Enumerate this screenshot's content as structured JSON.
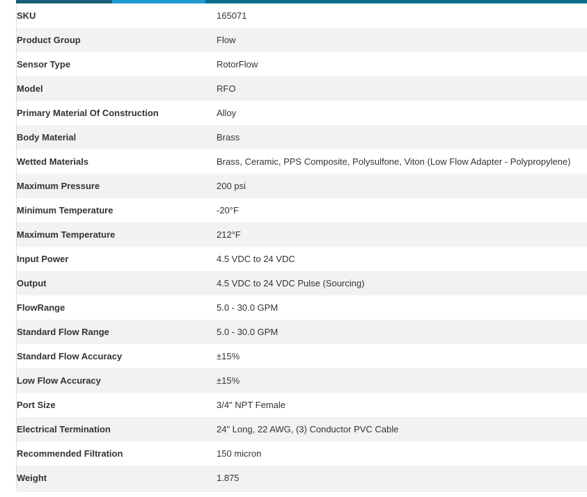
{
  "specifications": {
    "rows": [
      {
        "label": "SKU",
        "value": "165071"
      },
      {
        "label": "Product Group",
        "value": "Flow"
      },
      {
        "label": "Sensor Type",
        "value": "RotorFlow"
      },
      {
        "label": "Model",
        "value": "RFO"
      },
      {
        "label": "Primary Material Of Construction",
        "value": "Alloy"
      },
      {
        "label": "Body Material",
        "value": "Brass"
      },
      {
        "label": "Wetted Materials",
        "value": "Brass, Ceramic, PPS Composite, Polysulfone, Viton (Low Flow Adapter - Polypropylene)"
      },
      {
        "label": "Maximum Pressure",
        "value": "200 psi"
      },
      {
        "label": "Minimum Temperature",
        "value": "-20°F"
      },
      {
        "label": "Maximum Temperature",
        "value": "212°F"
      },
      {
        "label": "Input Power",
        "value": "4.5 VDC to 24 VDC"
      },
      {
        "label": "Output",
        "value": "4.5 VDC to 24 VDC Pulse (Sourcing)"
      },
      {
        "label": "FlowRange",
        "value": "5.0 - 30.0 GPM"
      },
      {
        "label": "Standard Flow Range",
        "value": "5.0 - 30.0 GPM"
      },
      {
        "label": "Standard Flow Accuracy",
        "value": "±15%"
      },
      {
        "label": "Low Flow Accuracy",
        "value": "±15%"
      },
      {
        "label": "Port Size",
        "value": "3/4\" NPT Female"
      },
      {
        "label": "Electrical Termination",
        "value": "24\" Long, 22 AWG, (3) Conductor PVC Cable"
      },
      {
        "label": "Recommended Filtration",
        "value": "150 micron"
      },
      {
        "label": "Weight",
        "value": "1.875"
      }
    ]
  },
  "theme": {
    "tab_bar_color": "#0b6f8c",
    "active_tab_color": "#1f9bd1",
    "stripe_color": "#f2f2f2"
  }
}
